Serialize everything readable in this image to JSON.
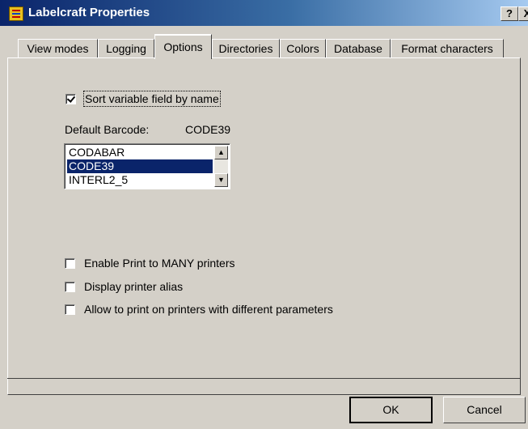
{
  "window": {
    "title": "Labelcraft Properties"
  },
  "titlebar": {
    "help_label": "?",
    "close_label": "X"
  },
  "tabs": [
    {
      "label": "View modes"
    },
    {
      "label": "Logging"
    },
    {
      "label": "Options",
      "active": true
    },
    {
      "label": "Directories"
    },
    {
      "label": "Colors"
    },
    {
      "label": "Database"
    },
    {
      "label": "Format characters"
    }
  ],
  "options": {
    "sort_variable": {
      "label": "Sort variable field by name",
      "checked": true
    },
    "default_barcode": {
      "label": "Default Barcode:",
      "value": "CODE39"
    },
    "barcode_list": {
      "items": [
        "CODABAR",
        "CODE39",
        "INTERL2_5"
      ],
      "selected": "CODE39"
    },
    "enable_print_many": {
      "label": "Enable Print to MANY printers",
      "checked": false
    },
    "display_printer_alias": {
      "label": "Display printer alias",
      "checked": false
    },
    "allow_different_params": {
      "label": "Allow to print on printers with different parameters",
      "checked": false
    }
  },
  "buttons": {
    "ok": "OK",
    "cancel": "Cancel"
  }
}
